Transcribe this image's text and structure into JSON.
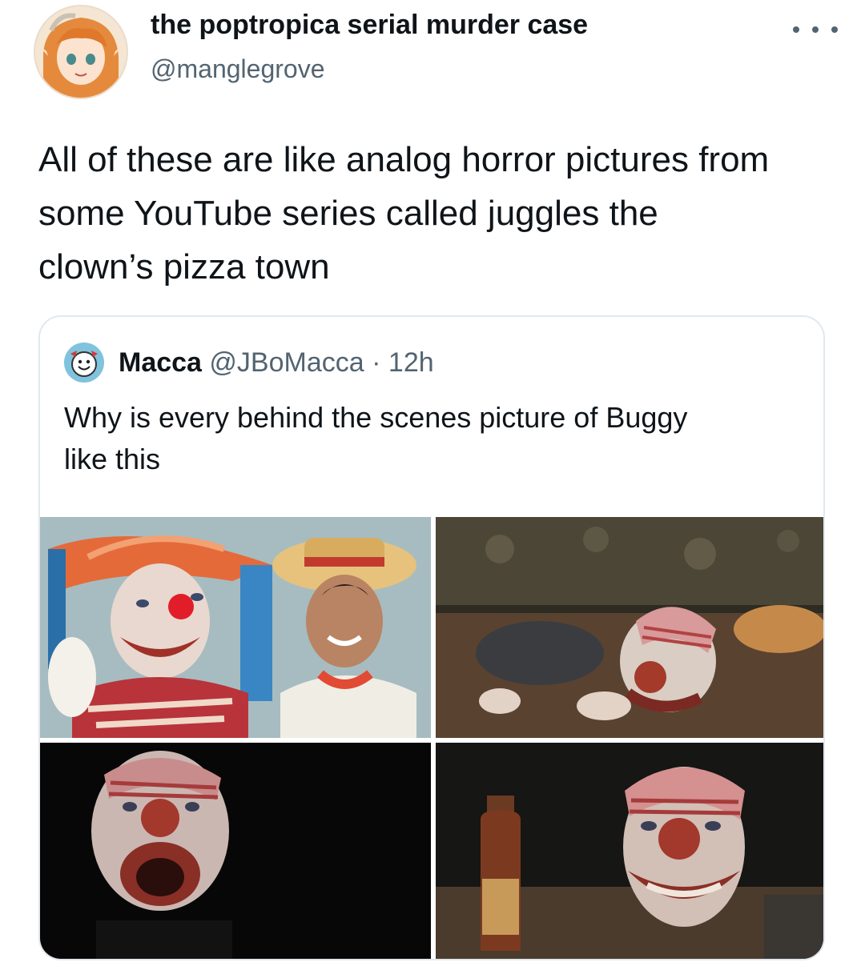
{
  "post": {
    "display_name": "the poptropica serial murder case",
    "handle": "@manglegrove",
    "text": "All of these are like analog horror pictures from\nsome YouTube series called juggles the\nclown’s pizza town",
    "more_icon": "more-horizontal-icon"
  },
  "quote": {
    "name": "Macca",
    "handle": "@JBoMacca",
    "separator": "·",
    "time": "12h",
    "text": "Why is every behind the scenes picture of Buggy\nlike this",
    "photos": [
      {
        "name": "photo-clown-with-straw-hat-friend"
      },
      {
        "name": "photo-clown-applying-makeup"
      },
      {
        "name": "photo-clown-mouth-open-dark"
      },
      {
        "name": "photo-clown-with-bottle"
      }
    ]
  },
  "colors": {
    "text": "#0f1419",
    "secondary": "#536471",
    "border": "#e1e8ed"
  }
}
